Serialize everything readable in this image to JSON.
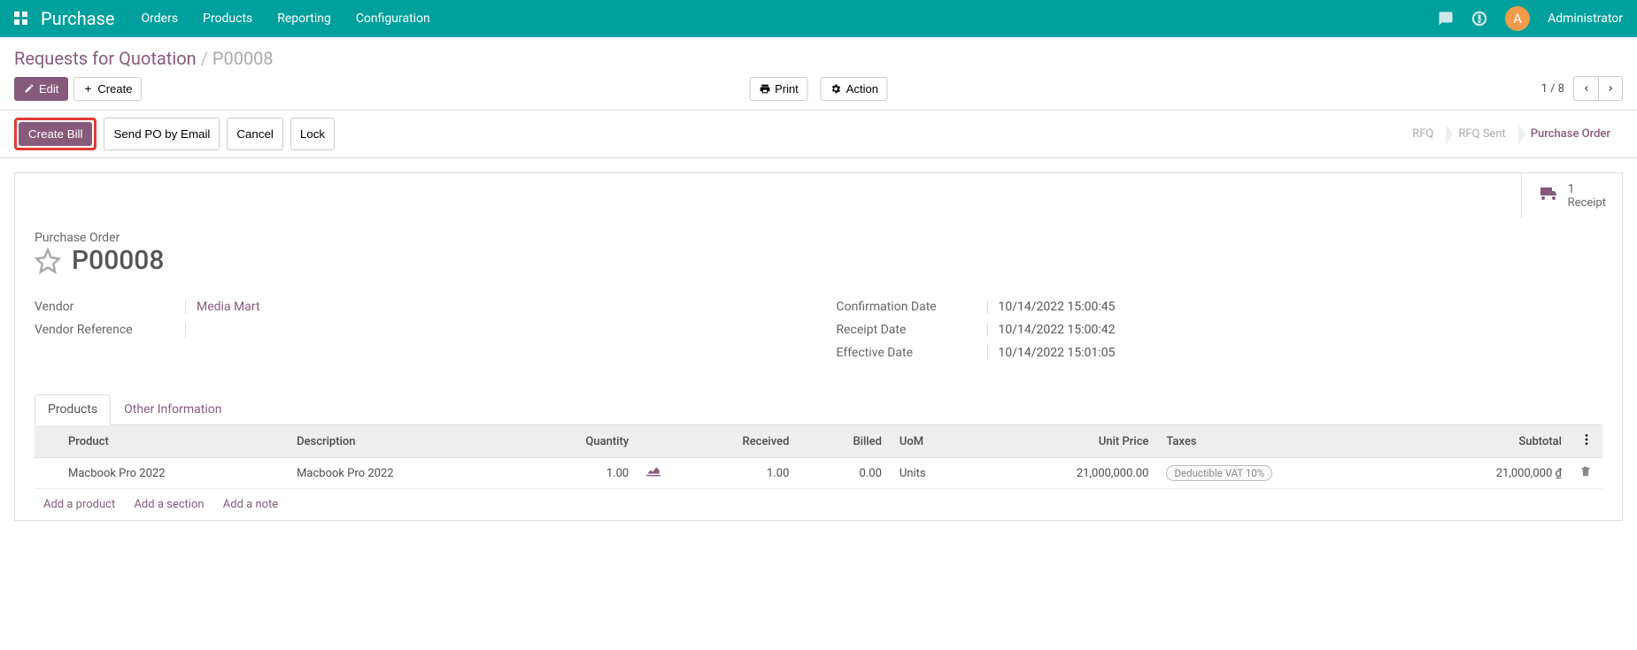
{
  "topnav": {
    "brand": "Purchase",
    "menu": [
      "Orders",
      "Products",
      "Reporting",
      "Configuration"
    ],
    "user_initial": "A",
    "user_name": "Administrator"
  },
  "breadcrumb": {
    "parent": "Requests for Quotation",
    "current": "P00008"
  },
  "toolbar": {
    "edit": "Edit",
    "create": "Create",
    "print": "Print",
    "action": "Action",
    "pager": "1 / 8"
  },
  "status": {
    "create_bill": "Create Bill",
    "send_po": "Send PO by Email",
    "cancel": "Cancel",
    "lock": "Lock",
    "stages": [
      "RFQ",
      "RFQ Sent",
      "Purchase Order"
    ],
    "active_stage": 2
  },
  "stat": {
    "count": "1",
    "label": "Receipt"
  },
  "form": {
    "type_label": "Purchase Order",
    "name": "P00008",
    "vendor_label": "Vendor",
    "vendor": "Media Mart",
    "vendor_ref_label": "Vendor Reference",
    "vendor_ref": "",
    "confirm_date_label": "Confirmation Date",
    "confirm_date": "10/14/2022 15:00:45",
    "receipt_date_label": "Receipt Date",
    "receipt_date": "10/14/2022 15:00:42",
    "effective_date_label": "Effective Date",
    "effective_date": "10/14/2022 15:01:05"
  },
  "tabs": {
    "products": "Products",
    "other": "Other Information"
  },
  "table": {
    "headers": {
      "product": "Product",
      "description": "Description",
      "quantity": "Quantity",
      "received": "Received",
      "billed": "Billed",
      "uom": "UoM",
      "unit_price": "Unit Price",
      "taxes": "Taxes",
      "subtotal": "Subtotal"
    },
    "row": {
      "product": "Macbook Pro 2022",
      "description": "Macbook Pro 2022",
      "quantity": "1.00",
      "received": "1.00",
      "billed": "0.00",
      "uom": "Units",
      "unit_price": "21,000,000.00",
      "tax": "Deductible VAT 10%",
      "subtotal": "21,000,000 ₫"
    },
    "add_product": "Add a product",
    "add_section": "Add a section",
    "add_note": "Add a note"
  }
}
